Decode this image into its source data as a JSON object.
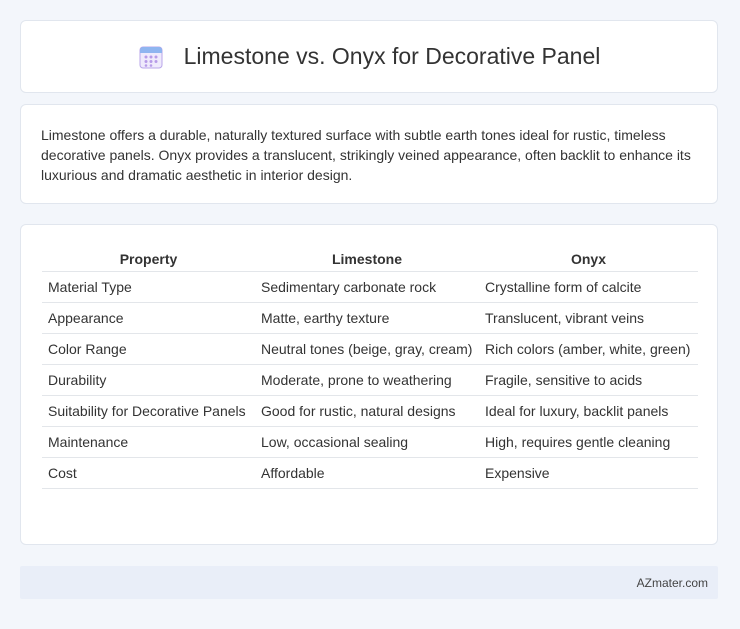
{
  "header": {
    "title": "Limestone vs. Onyx for Decorative Panel",
    "icon": "calendar-icon"
  },
  "intro": {
    "text": "Limestone offers a durable, naturally textured surface with subtle earth tones ideal for rustic, timeless decorative panels. Onyx provides a translucent, strikingly veined appearance, often backlit to enhance its luxurious and dramatic aesthetic in interior design."
  },
  "table": {
    "headers": [
      "Property",
      "Limestone",
      "Onyx"
    ],
    "rows": [
      [
        "Material Type",
        "Sedimentary carbonate rock",
        "Crystalline form of calcite"
      ],
      [
        "Appearance",
        "Matte, earthy texture",
        "Translucent, vibrant veins"
      ],
      [
        "Color Range",
        "Neutral tones (beige, gray, cream)",
        "Rich colors (amber, white, green)"
      ],
      [
        "Durability",
        "Moderate, prone to weathering",
        "Fragile, sensitive to acids"
      ],
      [
        "Suitability for Decorative Panels",
        "Good for rustic, natural designs",
        "Ideal for luxury, backlit panels"
      ],
      [
        "Maintenance",
        "Low, occasional sealing",
        "High, requires gentle cleaning"
      ],
      [
        "Cost",
        "Affordable",
        "Expensive"
      ]
    ]
  },
  "footer": {
    "brand": "AZmater.com"
  },
  "colors": {
    "background": "#f3f6fb",
    "card": "#ffffff",
    "footer": "#e9eef8",
    "icon_accent": "#a98fe0"
  }
}
